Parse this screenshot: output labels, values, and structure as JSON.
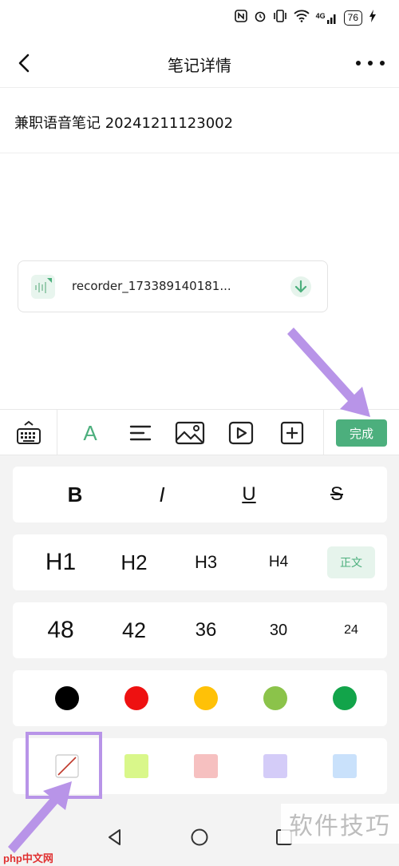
{
  "status_bar": {
    "icons": [
      "nfc-icon",
      "vibrate-icon",
      "wifi-icon",
      "signal-4g-icon",
      "charging-icon"
    ],
    "signal_label": "4G",
    "battery": "76"
  },
  "header": {
    "title": "笔记详情"
  },
  "note": {
    "title": "兼职语音笔记 20241211123002"
  },
  "attachment": {
    "filename": "recorder_173389140181..."
  },
  "toolbar": {
    "font_label": "A",
    "done_label": "完成"
  },
  "format_panel": {
    "styles": [
      "B",
      "I",
      "U",
      "S"
    ],
    "headings": [
      "H1",
      "H2",
      "H3",
      "H4"
    ],
    "body_label": "正文",
    "sizes": [
      "48",
      "42",
      "36",
      "30",
      "24"
    ],
    "text_colors": [
      "#000000",
      "#ee1111",
      "#ffc107",
      "#8bc34a",
      "#12a44a"
    ],
    "highlight_colors": [
      "none",
      "#d9f78a",
      "#f6c0c0",
      "#d4ccf8",
      "#c9e1fb"
    ]
  },
  "colors": {
    "accent": "#4caf7d",
    "annotation": "#b894e8"
  },
  "watermark": {
    "text": "软件技巧",
    "site": "php中文网"
  }
}
